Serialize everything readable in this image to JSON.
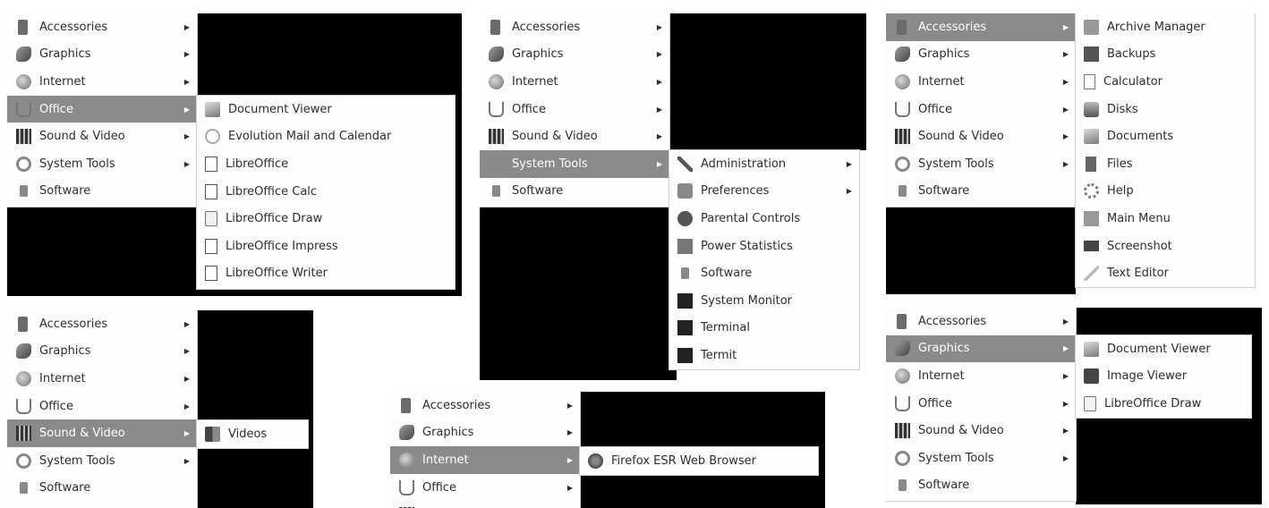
{
  "categories": [
    "Accessories",
    "Graphics",
    "Internet",
    "Office",
    "Sound & Video",
    "System Tools",
    "Software"
  ],
  "panels": {
    "office": {
      "active": "Office",
      "items": [
        "Document Viewer",
        "Evolution Mail and Calendar",
        "LibreOffice",
        "LibreOffice Calc",
        "LibreOffice Draw",
        "LibreOffice Impress",
        "LibreOffice Writer"
      ]
    },
    "system_tools": {
      "active": "System Tools",
      "items": [
        "Administration",
        "Preferences",
        "Parental Controls",
        "Power Statistics",
        "Software",
        "System Monitor",
        "Terminal",
        "Termit"
      ]
    },
    "accessories": {
      "active": "Accessories",
      "items": [
        "Archive Manager",
        "Backups",
        "Calculator",
        "Disks",
        "Documents",
        "Files",
        "Help",
        "Main Menu",
        "Screenshot",
        "Text Editor"
      ]
    },
    "sound_video": {
      "active": "Sound & Video",
      "items": [
        "Videos"
      ]
    },
    "internet": {
      "active": "Internet",
      "items": [
        "Firefox ESR Web Browser"
      ]
    },
    "graphics": {
      "active": "Graphics",
      "items": [
        "Document Viewer",
        "Image Viewer",
        "LibreOffice Draw"
      ]
    }
  },
  "icons": {
    "categories": [
      "accessories-icon",
      "graphics-icon",
      "internet-icon",
      "office-icon",
      "sound-video-icon",
      "system-tools-icon",
      "software-icon"
    ]
  }
}
